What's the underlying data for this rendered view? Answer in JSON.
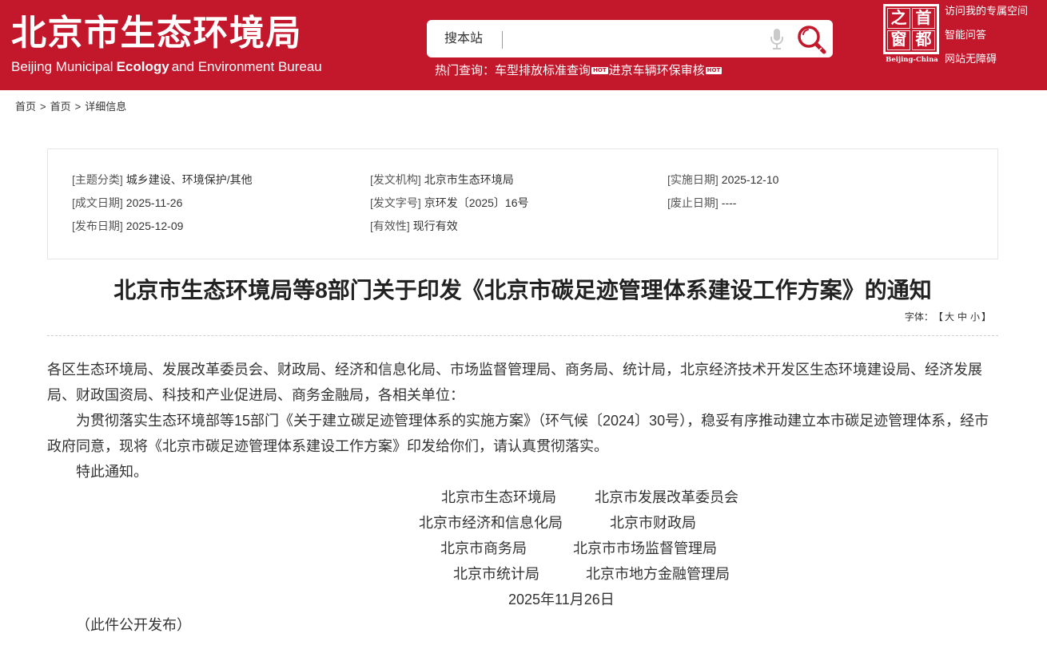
{
  "colors": {
    "brand_red": "#c3172c",
    "text": "#333333"
  },
  "header": {
    "site_title": "北京市生态环境局",
    "site_subtitle": {
      "part1": "Beijing Municipal",
      "part2": "Ecology",
      "part3": "and Environment Bureau"
    },
    "search": {
      "scope_label": "搜本站",
      "value": "",
      "mic_icon": "microphone-icon",
      "search_icon": "search-icon"
    },
    "hot_queries": {
      "label": "热门查询：",
      "items": [
        {
          "text": "车型排放标准查询",
          "badge": "HOT"
        },
        {
          "text": "进京车辆环保审核",
          "badge": "HOT"
        }
      ]
    },
    "logo": {
      "chars": [
        "之",
        "首",
        "窗",
        "都"
      ],
      "caption": "Beijing-China"
    },
    "links": [
      "访问我的专属空间",
      "智能问答",
      "网站无障碍"
    ]
  },
  "breadcrumb": {
    "items": [
      "首页",
      "首页",
      "详细信息"
    ],
    "separator": ">"
  },
  "metadata": {
    "columns": [
      [
        {
          "label": "[主题分类]",
          "value": "城乡建设、环境保护/其他"
        },
        {
          "label": "[成文日期]",
          "value": "2025-11-26"
        },
        {
          "label": "[发布日期]",
          "value": "2025-12-09"
        }
      ],
      [
        {
          "label": "[发文机构]",
          "value": "北京市生态环境局"
        },
        {
          "label": "[发文字号]",
          "value": "京环发〔2025〕16号"
        },
        {
          "label": "[有效性]",
          "value": "现行有效"
        }
      ],
      [
        {
          "label": "[实施日期]",
          "value": "2025-12-10"
        },
        {
          "label": "[废止日期]",
          "value": "----"
        }
      ]
    ]
  },
  "article": {
    "title": "北京市生态环境局等8部门关于印发《北京市碳足迹管理体系建设工作方案》的通知",
    "font_size_control": {
      "label": "字体：",
      "open": "【",
      "sizes": [
        "大",
        "中",
        "小"
      ],
      "close": "】"
    },
    "salutation": "各区生态环境局、发展改革委员会、财政局、经济和信息化局、市场监督管理局、商务局、统计局，北京经济技术开发区生态环境建设局、经济发展局、财政国资局、科技和产业促进局、商务金融局，各相关单位：",
    "paragraph": "为贯彻落实生态环境部等15部门《关于建立碳足迹管理体系的实施方案》（环气候〔2024〕30号），稳妥有序推动建立本市碳足迹管理体系，经市政府同意，现将《北京市碳足迹管理体系建设工作方案》印发给你们，请认真贯彻落实。",
    "closing": "特此通知。",
    "signatories": [
      [
        "北京市生态环境局",
        "北京市发展改革委员会"
      ],
      [
        "北京市经济和信息化局",
        "北京市财政局"
      ],
      [
        "北京市商务局",
        "北京市市场监督管理局"
      ],
      [
        "北京市统计局",
        "北京市地方金融管理局"
      ]
    ],
    "date": "2025年11月26日",
    "release_note": "（此件公开发布）"
  }
}
